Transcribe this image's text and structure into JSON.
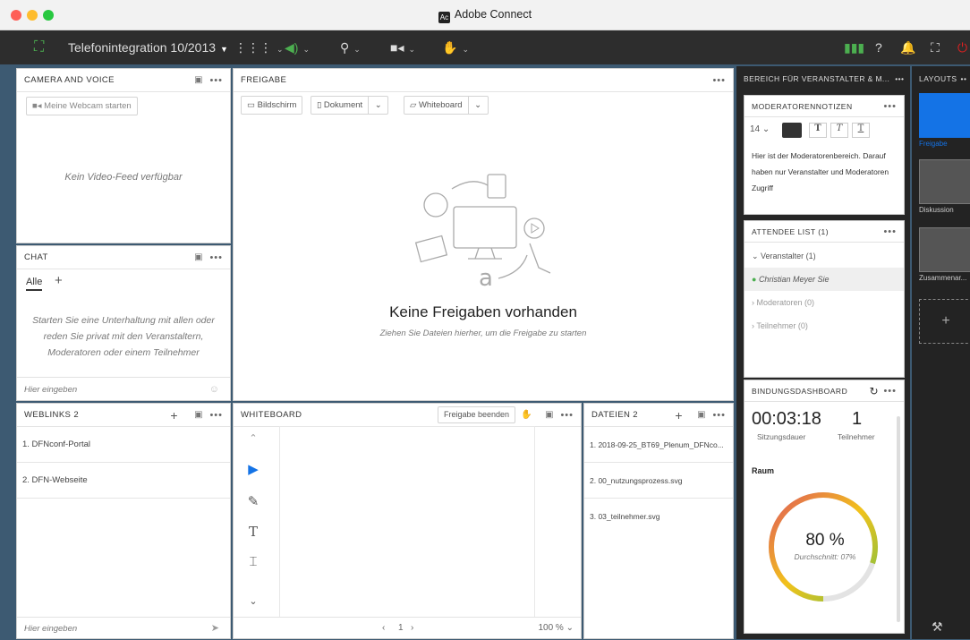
{
  "window": {
    "title": "Adobe Connect"
  },
  "toolbar": {
    "meeting_title": "Telefonintegration 10/2013"
  },
  "camera": {
    "title": "CAMERA AND VOICE",
    "webcam_button": "Meine Webcam starten",
    "empty": "Kein Video-Feed verfügbar"
  },
  "chat": {
    "title": "CHAT",
    "tab_all": "Alle",
    "add": "+",
    "empty": "Starten Sie eine Unterhaltung mit allen oder reden Sie privat mit den Veranstaltern, Moderatoren oder einem Teilnehmer",
    "placeholder": "Hier eingeben"
  },
  "weblinks": {
    "title": "WEBLINKS 2",
    "items": [
      "1. DFNconf-Portal",
      "2. DFN-Webseite"
    ],
    "placeholder": "Hier eingeben"
  },
  "share": {
    "title": "FREIGABE",
    "screen": "Bildschirm",
    "document": "Dokument",
    "whiteboard": "Whiteboard",
    "empty_title": "Keine Freigaben vorhanden",
    "empty_hint": "Ziehen Sie Dateien hierher, um die Freigabe zu starten"
  },
  "whiteboard": {
    "title": "WHITEBOARD",
    "stop": "Freigabe beenden",
    "page": "1",
    "zoom": "100 %"
  },
  "files": {
    "title": "DATEIEN 2",
    "items": [
      "1. 2018-09-25_BT69_Plenum_DFNco...",
      "2. 00_nutzungsprozess.svg",
      "3. 03_teilnehmer.svg"
    ]
  },
  "host_area": {
    "title": "BEREICH FÜR VERANSTALTER & M..."
  },
  "notes": {
    "title": "MODERATORENNOTIZEN",
    "font_size": "14",
    "text": "Hier ist der Moderatorenbereich. Darauf haben nur Veranstalter und Moderatoren Zugriff"
  },
  "attendees": {
    "title": "ATTENDEE LIST  (1)",
    "hosts": "Veranstalter (1)",
    "host_name": "Christian Meyer Sie",
    "moderators": "Moderatoren (0)",
    "participants": "Teilnehmer (0)"
  },
  "engagement": {
    "title": "BINDUNGSDASHBOARD",
    "duration": "00:03:18",
    "duration_label": "Sitzungsdauer",
    "count": "1",
    "count_label": "Teilnehmer",
    "room": "Raum",
    "percent": "80 %",
    "percent_value": 80,
    "average": "Durchschnitt: 07%"
  },
  "layouts": {
    "title": "LAYOUTS",
    "items": [
      "Freigabe",
      "Diskussion",
      "Zusammenar..."
    ],
    "add": "+"
  },
  "colors": {
    "accent": "#1473e6",
    "green": "#4caf50",
    "red": "#e02020"
  }
}
